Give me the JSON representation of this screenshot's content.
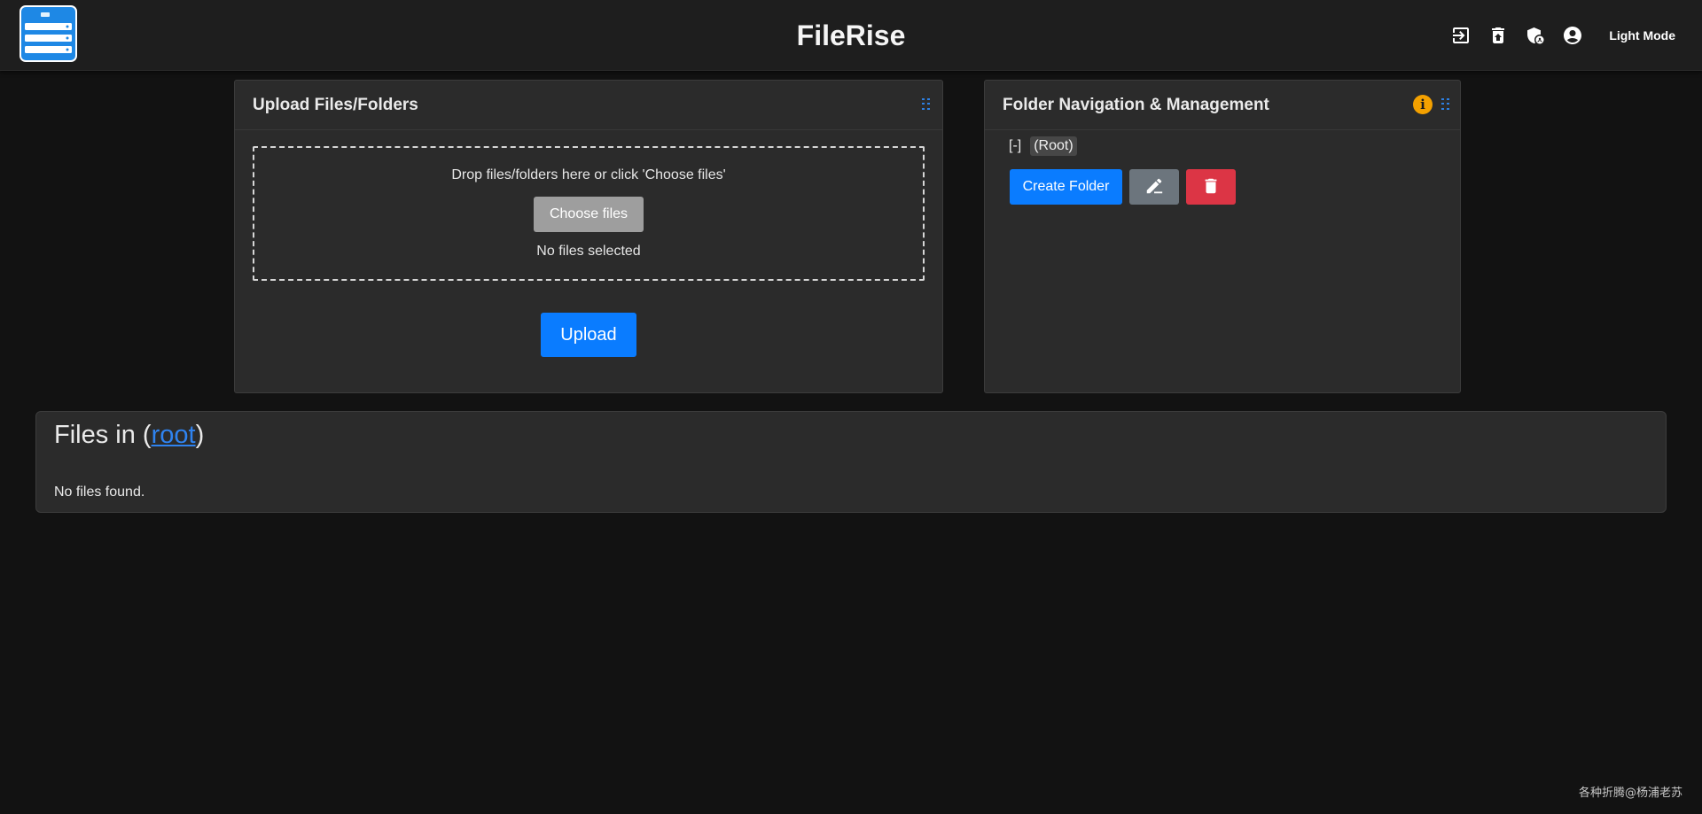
{
  "header": {
    "title": "FileRise",
    "logo_icon": "server-rack-icon",
    "actions": [
      {
        "icon": "logout-icon"
      },
      {
        "icon": "trash-restore-icon"
      },
      {
        "icon": "admin-shield-icon"
      },
      {
        "icon": "user-account-icon"
      }
    ],
    "theme_toggle_label": "Light Mode"
  },
  "upload": {
    "title": "Upload Files/Folders",
    "drop_text": "Drop files/folders here or click 'Choose files'",
    "choose_label": "Choose files",
    "status": "No files selected",
    "upload_label": "Upload"
  },
  "folders": {
    "title": "Folder Navigation & Management",
    "tree_toggle": "[-]",
    "root_label": "(Root)",
    "create_label": "Create Folder",
    "rename_icon": "rename-icon",
    "delete_icon": "trash-icon"
  },
  "files": {
    "title_prefix": "Files in (",
    "folder_link": "root",
    "title_suffix": ")",
    "empty_text": "No files found."
  },
  "watermark": "各种折腾@杨浦老苏",
  "colors": {
    "primary": "#0a7cff",
    "danger": "#dc3545",
    "secondary": "#6c757d",
    "info": "#f4a100",
    "background": "#121212",
    "card": "#2b2b2b"
  }
}
